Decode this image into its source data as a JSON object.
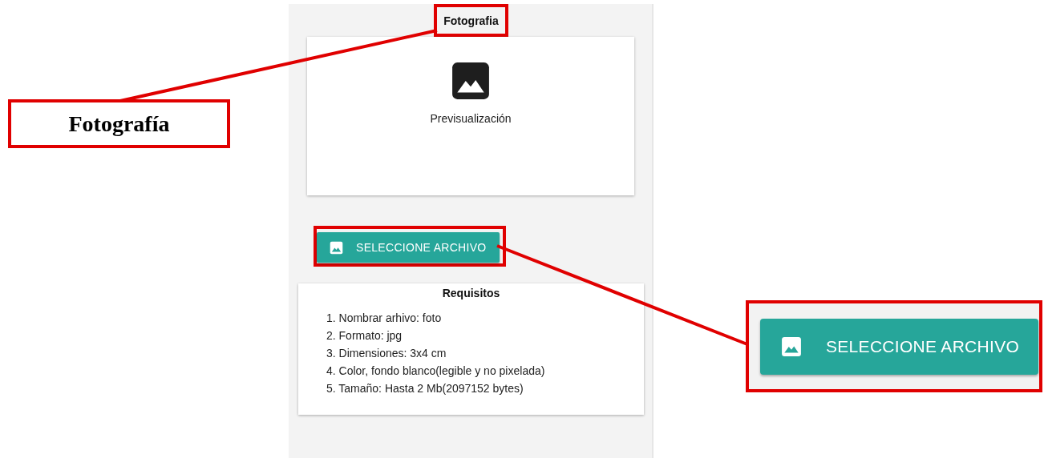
{
  "panel": {
    "title": "Fotografia",
    "preview": {
      "label": "Previsualización"
    },
    "button": {
      "label": "SELECCIONE ARCHIVO"
    },
    "requirements": {
      "title": "Requisitos",
      "items": [
        "1. Nombrar arhivo: foto",
        "2. Formato: jpg",
        "3. Dimensiones: 3x4 cm",
        "4. Color, fondo blanco(legible y no pixelada)",
        "5. Tamaño: Hasta 2 Mb(2097152 bytes)"
      ]
    }
  },
  "callouts": [
    {
      "kind": "label",
      "text": "Fotografía"
    },
    {
      "kind": "button-zoom",
      "label": "SELECCIONE ARCHIVO"
    }
  ]
}
